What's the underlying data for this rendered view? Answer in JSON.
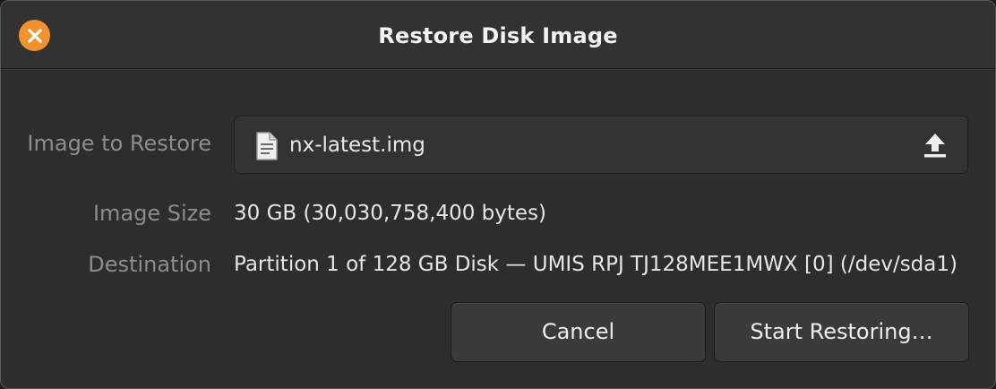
{
  "window": {
    "title": "Restore Disk Image",
    "close_icon": "close-icon",
    "close_color": "#f0922e"
  },
  "form": {
    "image_label": "Image to Restore",
    "image_file": "nx-latest.img",
    "file_icon": "document-icon",
    "upload_icon": "upload-icon",
    "size_label": "Image Size",
    "size_value": "30 GB (30,030,758,400 bytes)",
    "destination_label": "Destination",
    "destination_value": "Partition 1 of 128 GB Disk — UMIS RPJ TJ128MEE1MWX [0] (/dev/sda1)"
  },
  "buttons": {
    "cancel_label": "Cancel",
    "start_label": "Start Restoring…"
  }
}
